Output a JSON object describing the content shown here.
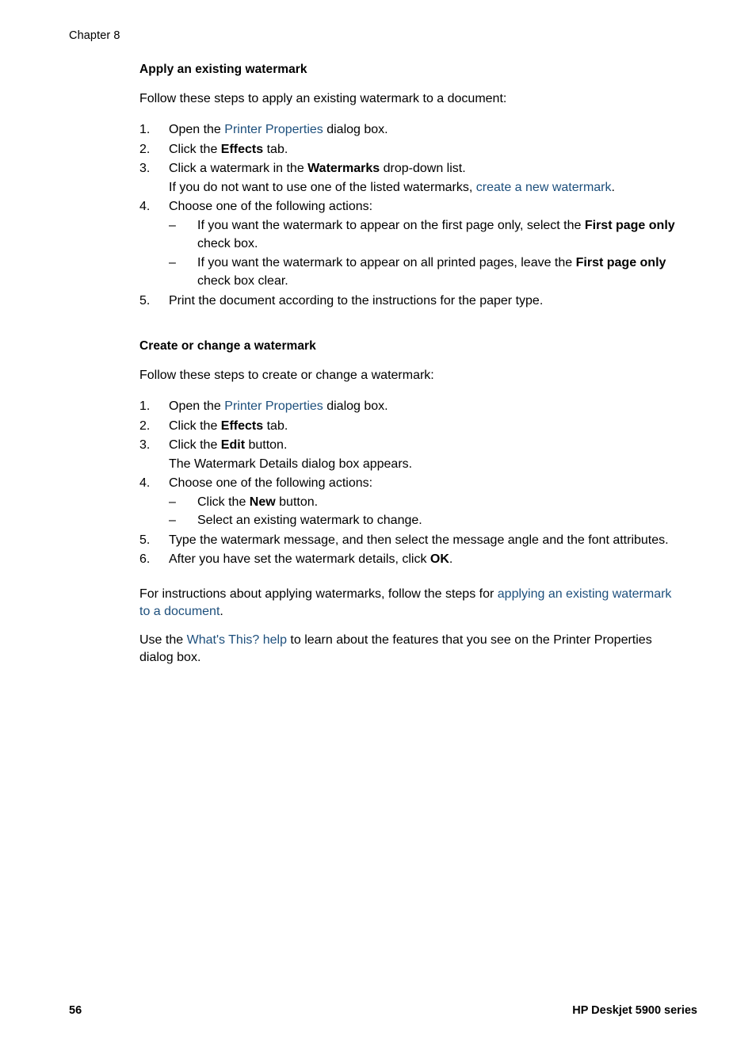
{
  "header": {
    "chapter": "Chapter 8"
  },
  "sections": [
    {
      "heading": "Apply an existing watermark",
      "intro": "Follow these steps to apply an existing watermark to a document:",
      "steps": [
        {
          "num": "1.",
          "pre": "Open the ",
          "link": "Printer Properties",
          "post": " dialog box."
        },
        {
          "num": "2.",
          "pre": "Click the ",
          "bold": "Effects",
          "post": " tab."
        },
        {
          "num": "3.",
          "pre": "Click a watermark in the ",
          "bold": "Watermarks",
          "post": " drop-down list.",
          "sub_pre": "If you do not want to use one of the listed watermarks, ",
          "sub_link": "create a new watermark",
          "sub_post": "."
        },
        {
          "num": "4.",
          "text": "Choose one of the following actions:",
          "bullets": [
            {
              "dash": "–",
              "pre": "If you want the watermark to appear on the first page only, select the ",
              "bold": "First page only",
              "post": " check box."
            },
            {
              "dash": "–",
              "pre": "If you want the watermark to appear on all printed pages, leave the ",
              "bold": "First page only",
              "post": " check box clear."
            }
          ]
        },
        {
          "num": "5.",
          "text": "Print the document according to the instructions for the paper type."
        }
      ]
    },
    {
      "heading": "Create or change a watermark",
      "intro": "Follow these steps to create or change a watermark:",
      "steps": [
        {
          "num": "1.",
          "pre": "Open the ",
          "link": "Printer Properties",
          "post": " dialog box."
        },
        {
          "num": "2.",
          "pre": "Click the ",
          "bold": "Effects",
          "post": " tab."
        },
        {
          "num": "3.",
          "pre": "Click the ",
          "bold": "Edit",
          "post": " button.",
          "sub_text": "The Watermark Details dialog box appears."
        },
        {
          "num": "4.",
          "text": "Choose one of the following actions:",
          "bullets": [
            {
              "dash": "–",
              "pre": "Click the ",
              "bold": "New",
              "post": " button."
            },
            {
              "dash": "–",
              "text": "Select an existing watermark to change."
            }
          ]
        },
        {
          "num": "5.",
          "text": "Type the watermark message, and then select the message angle and the font attributes."
        },
        {
          "num": "6.",
          "pre": "After you have set the watermark details, click ",
          "bold": "OK",
          "post": "."
        }
      ],
      "closing_paragraphs": [
        {
          "pre": "For instructions about applying watermarks, follow the steps for ",
          "link": "applying an existing watermark to a document",
          "post": "."
        },
        {
          "pre": "Use the ",
          "link": "What's This? help",
          "post": " to learn about the features that you see on the Printer Properties dialog box."
        }
      ]
    }
  ],
  "footer": {
    "page_number": "56",
    "product": "HP Deskjet 5900 series"
  },
  "colors": {
    "link": "#1d4f7c",
    "text": "#000000",
    "page_background": "#ffffff"
  }
}
